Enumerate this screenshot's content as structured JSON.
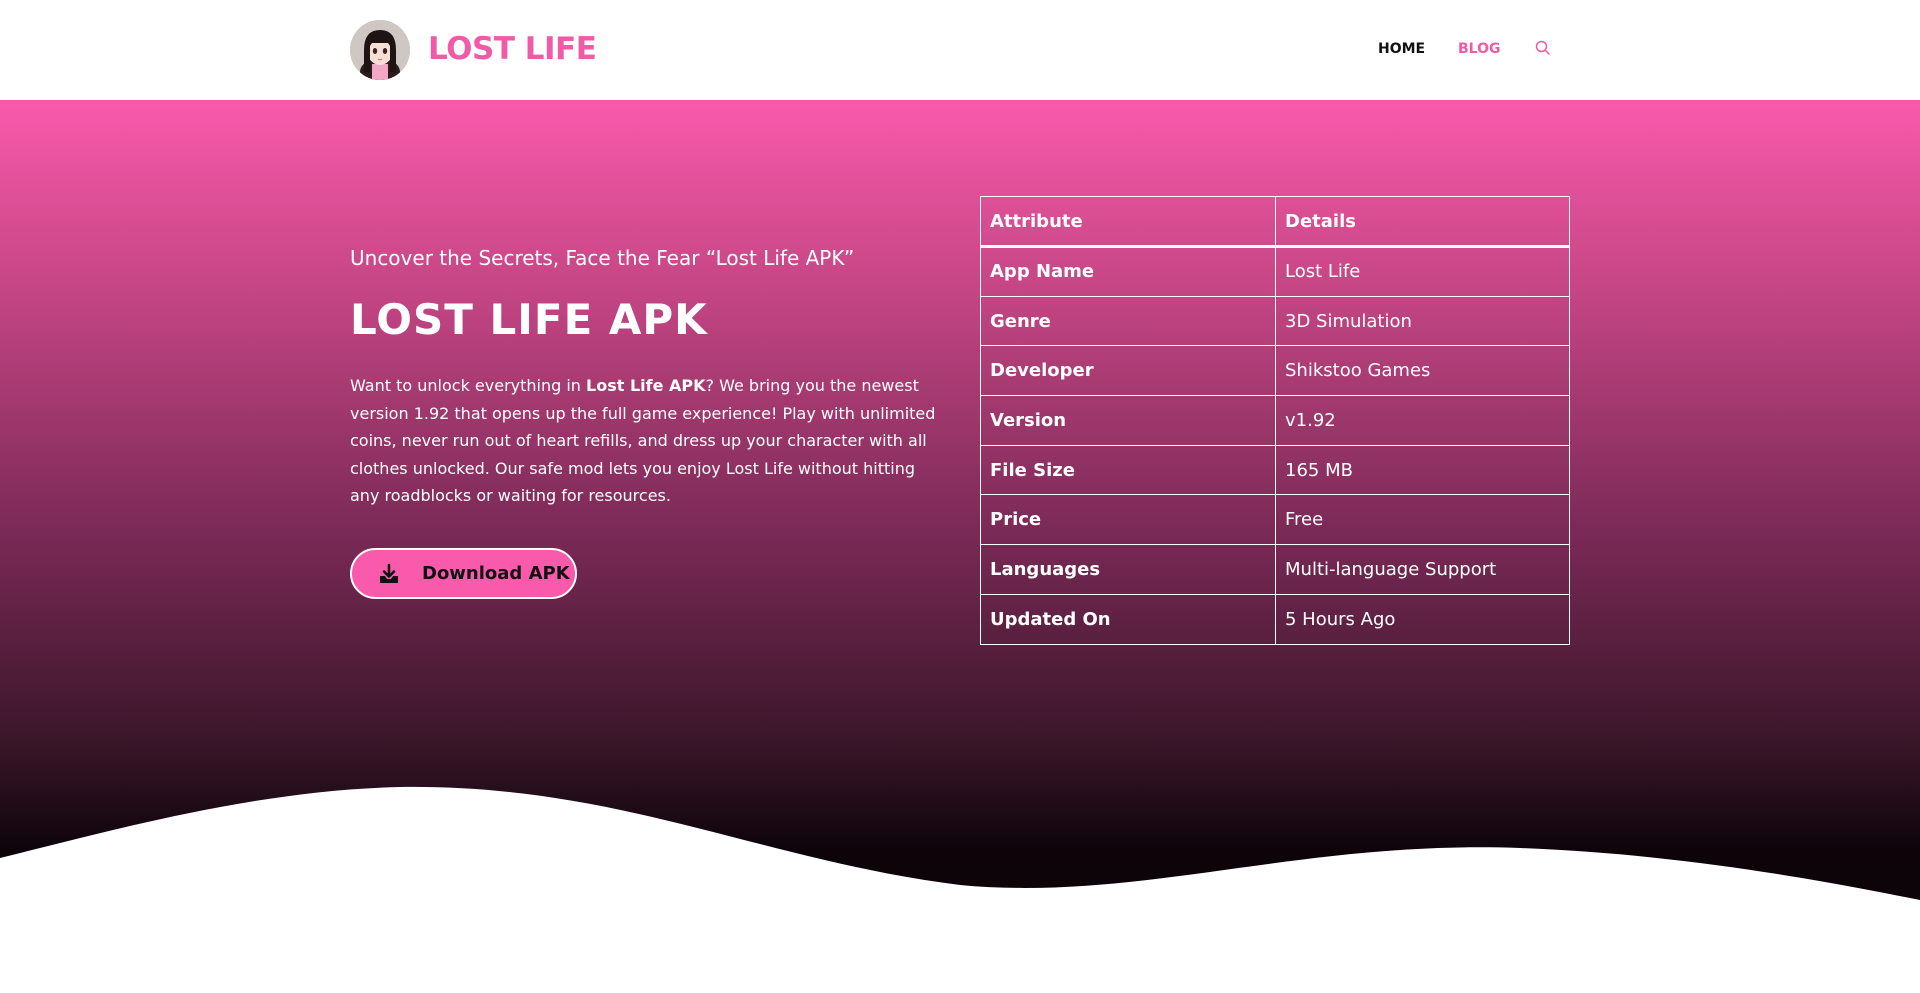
{
  "header": {
    "site_title": "LOST LIFE",
    "nav": [
      {
        "label": "HOME"
      },
      {
        "label": "BLOG"
      }
    ],
    "search_icon": "search-icon",
    "accent_color": "#f05aa6"
  },
  "hero": {
    "tagline": "Uncover the Secrets, Face the Fear “Lost Life APK”",
    "headline": "LOST LIFE APK",
    "description": {
      "part1": "Want to unlock everything in ",
      "bold": "Lost Life APK",
      "part2": "? We bring you the newest version 1.92 that opens up the full game experience! Play with unlimited coins, never run out of heart refills, and dress up your character with all clothes unlocked. Our safe mod lets you enjoy Lost Life without hitting any roadblocks or waiting for resources."
    },
    "download_button": {
      "label": "Download APK",
      "icon": "download-icon"
    },
    "gradient_colors": [
      "#f95aab",
      "#7b2a57",
      "#0d040a"
    ]
  },
  "info_table": {
    "headers": [
      "Attribute",
      "Details"
    ],
    "rows": [
      {
        "attribute": "App Name",
        "details": "Lost Life"
      },
      {
        "attribute": "Genre",
        "details": "3D Simulation"
      },
      {
        "attribute": "Developer",
        "details": "Shikstoo Games"
      },
      {
        "attribute": "Version",
        "details": "v1.92"
      },
      {
        "attribute": "File Size",
        "details": "165 MB"
      },
      {
        "attribute": "Price",
        "details": "Free"
      },
      {
        "attribute": "Languages",
        "details": "Multi-language Support"
      },
      {
        "attribute": "Updated On",
        "details": "5 Hours Ago"
      }
    ]
  }
}
